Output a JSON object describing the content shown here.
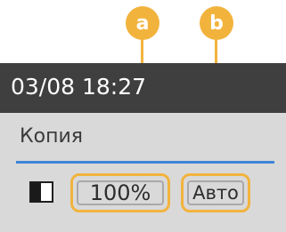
{
  "status": {
    "datetime": "03/08 18:27"
  },
  "screen": {
    "mode_title": "Копия"
  },
  "settings": {
    "zoom": "100%",
    "paper": "Авто",
    "density_icon": "contrast-icon"
  },
  "callouts": {
    "a": "a",
    "b": "b"
  },
  "colors": {
    "status_bar": "#3f3f3f",
    "screen_background": "#d9d9d9",
    "divider": "#3f86d8",
    "callout": "#f2b33d"
  }
}
